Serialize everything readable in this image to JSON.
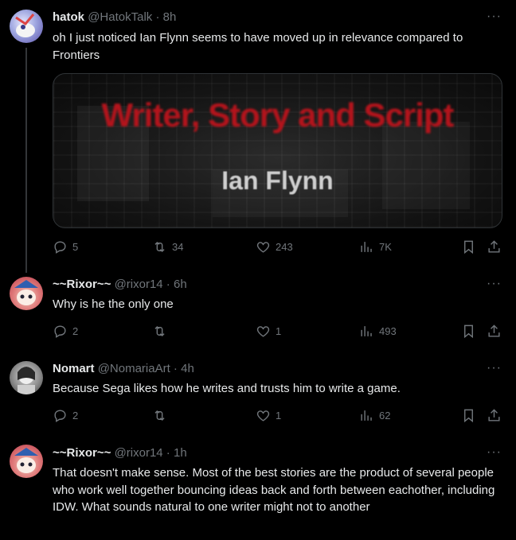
{
  "tweets": [
    {
      "name": "hatok",
      "handle": "@HatokTalk",
      "time": "8h",
      "text": "oh I just noticed Ian Flynn seems to have moved up in relevance compared to Frontiers",
      "media": {
        "title": "Writer, Story and Script",
        "subtitle": "Ian Flynn"
      },
      "replies": "5",
      "reposts": "34",
      "likes": "243",
      "views": "7K"
    },
    {
      "name": "~~Rixor~~",
      "handle": "@rixor14",
      "time": "6h",
      "text": "Why is he the only one",
      "replies": "2",
      "reposts": "",
      "likes": "1",
      "views": "493"
    },
    {
      "name": "Nomart",
      "handle": "@NomariaArt",
      "time": "4h",
      "text": "Because Sega likes how he writes and trusts him to write a game.",
      "replies": "2",
      "reposts": "",
      "likes": "1",
      "views": "62"
    },
    {
      "name": "~~Rixor~~",
      "handle": "@rixor14",
      "time": "1h",
      "text": "That doesn't make sense. Most of the best stories are the product of several people who work well together bouncing ideas back and forth between eachother, including IDW. What sounds natural to one writer might not to another"
    }
  ],
  "ui": {
    "more": "···",
    "sep": " · "
  }
}
